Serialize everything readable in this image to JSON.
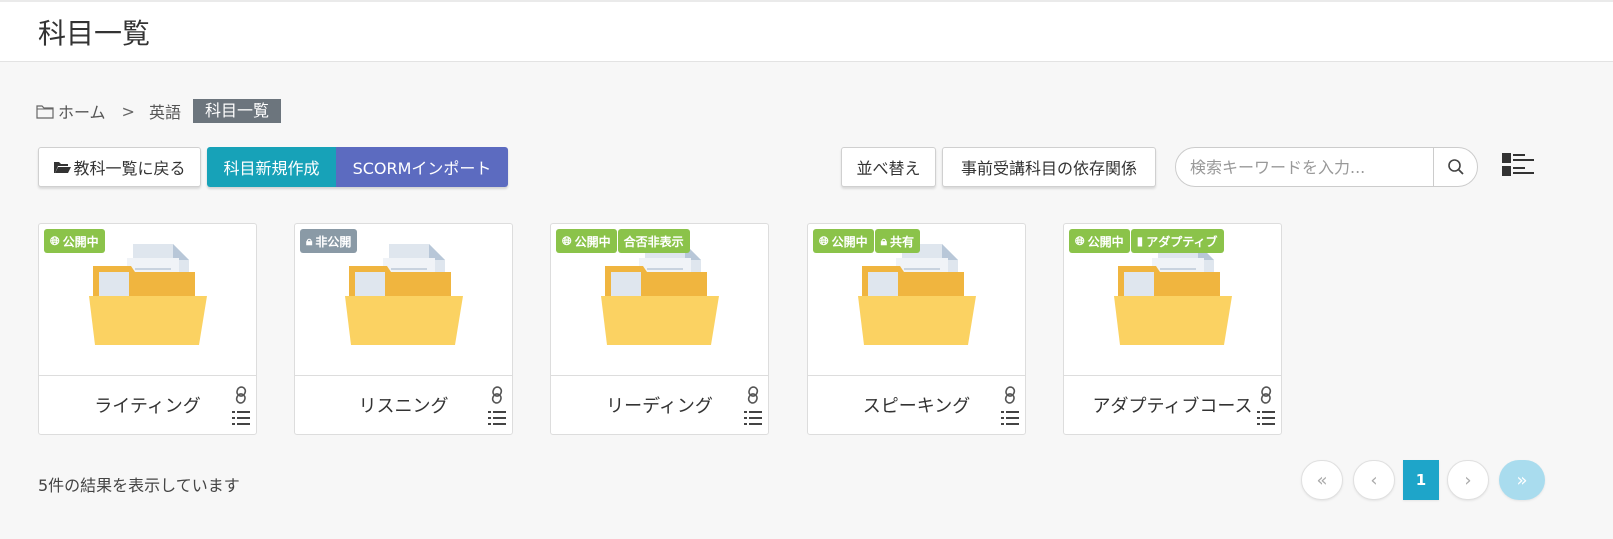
{
  "header": {
    "title": "科目一覧"
  },
  "breadcrumb": {
    "home": "ホーム",
    "separator": ">",
    "parent": "英語",
    "current": "科目一覧"
  },
  "toolbar": {
    "back_label": "教科一覧に戻る",
    "new_label": "科目新規作成",
    "scorm_label": "SCORMインポート",
    "sort_label": "並べ替え",
    "dependency_label": "事前受講科目の依存関係"
  },
  "search": {
    "placeholder": "検索キーワードを入力..."
  },
  "cards": [
    {
      "title": "ライティング",
      "badges": [
        {
          "label": "公開中",
          "icon": "globe-icon",
          "color": "#8bc34a"
        }
      ]
    },
    {
      "title": "リスニング",
      "badges": [
        {
          "label": "非公開",
          "icon": "lock-icon",
          "color": "#8a9aa6"
        }
      ]
    },
    {
      "title": "リーディング",
      "badges": [
        {
          "label": "公開中",
          "icon": "globe-icon",
          "color": "#8bc34a"
        },
        {
          "label": "合否非表示",
          "icon": "",
          "color": "#8bc34a"
        }
      ]
    },
    {
      "title": "スピーキング",
      "badges": [
        {
          "label": "公開中",
          "icon": "globe-icon",
          "color": "#8bc34a"
        },
        {
          "label": "共有",
          "icon": "lock-icon",
          "color": "#8bc34a"
        }
      ]
    },
    {
      "title": "アダプティブコース",
      "badges": [
        {
          "label": "公開中",
          "icon": "globe-icon",
          "color": "#8bc34a"
        },
        {
          "label": "アダプティブ",
          "icon": "book-icon",
          "color": "#8bc34a"
        }
      ]
    }
  ],
  "footer": {
    "result_text": "5件の結果を表示しています"
  },
  "pagination": {
    "first": "«",
    "prev": "‹",
    "current": "1",
    "next": "›",
    "last": "»"
  },
  "colors": {
    "accent": "#17a2b8",
    "scorm": "#5c6bc0",
    "public_badge": "#8bc34a",
    "private_badge": "#8a9aa6",
    "folder": "#f9cf5c"
  }
}
